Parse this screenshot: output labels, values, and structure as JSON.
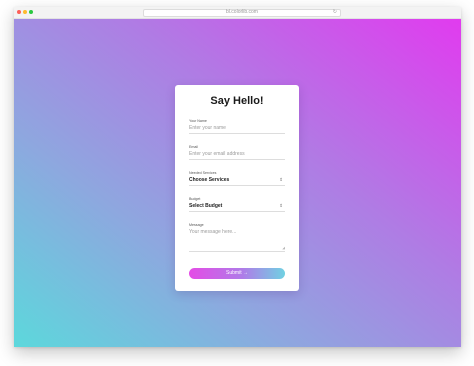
{
  "browser": {
    "url": "bl.colorlib.com",
    "reload_icon": "reload-icon"
  },
  "colors": {
    "gradient_start": "#5cd8dc",
    "gradient_end": "#e13bef",
    "button_start": "#e44ce6",
    "button_end": "#70d1e2"
  },
  "form": {
    "title": "Say Hello!",
    "name": {
      "label": "Your Name",
      "placeholder": "Enter your name"
    },
    "email": {
      "label": "Email",
      "placeholder": "Enter your email address"
    },
    "services": {
      "label": "Needed Services",
      "value": "Choose Services",
      "icon": "chevron-updown-icon"
    },
    "budget": {
      "label": "Budget",
      "value": "Select Budget",
      "icon": "chevron-updown-icon"
    },
    "message": {
      "label": "Message",
      "placeholder": "Your message here..."
    },
    "submit": {
      "label": "Submit",
      "icon": "arrow-right-icon"
    }
  }
}
